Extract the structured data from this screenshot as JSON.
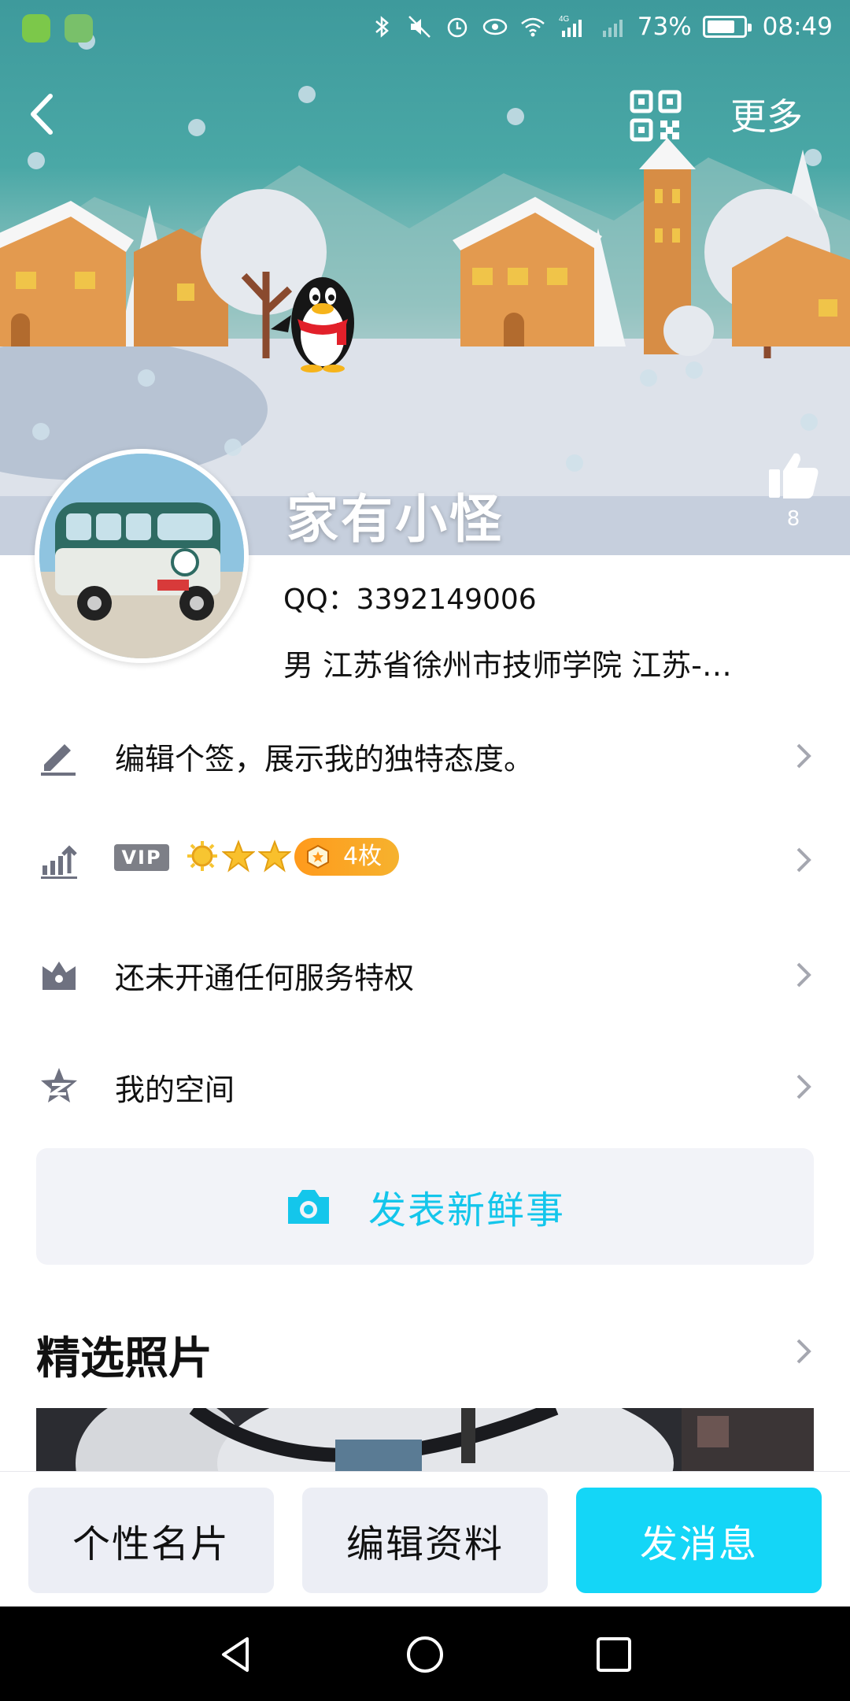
{
  "status_bar": {
    "battery": "73%",
    "time": "08:49",
    "network": "4G"
  },
  "header": {
    "more_label": "更多",
    "likes": "8"
  },
  "profile": {
    "nickname": "家有小怪",
    "qq_line": "QQ：3392149006",
    "detail_line": "男  江苏省徐州市技师学院  江苏-…"
  },
  "rows": {
    "signature": "编辑个签，展示我的独特态度。",
    "vip_badge": "VIP",
    "medal_count": "4枚",
    "service": "还未开通任何服务特权",
    "space": "我的空间"
  },
  "post_button": "发表新鲜事",
  "photos_section": {
    "title": "精选照片"
  },
  "bottom_bar": {
    "card": "个性名片",
    "edit": "编辑资料",
    "message": "发消息"
  },
  "colors": {
    "accent": "#14d6f7",
    "accent_text": "#14c6eb",
    "medal": "#ff9a1c"
  }
}
